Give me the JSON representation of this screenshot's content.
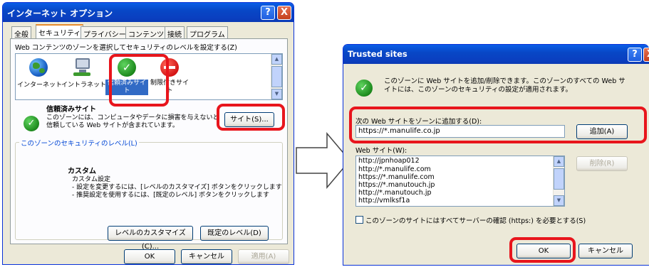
{
  "left_dialog": {
    "title": "インターネット オプション",
    "help_label": "?",
    "close_label": "X",
    "tabs": [
      "全般",
      "セキュリティ",
      "プライバシー",
      "コンテンツ",
      "接続",
      "プログラム"
    ],
    "zone_prompt": "Web コンテンツのゾーンを選択してセキュリティのレベルを設定する(Z)",
    "zones": [
      {
        "label": "インターネット",
        "icon": "globe-icon"
      },
      {
        "label": "イントラネット",
        "icon": "network-computer-icon"
      },
      {
        "label": "信頼済みサイト",
        "icon": "checkmark-icon"
      },
      {
        "label": "制限付きサイト",
        "icon": "forbidden-icon"
      }
    ],
    "zone_title": "信頼済みサイト",
    "zone_desc_line1": "このゾーンには、コンピュータやデータに損害を与えないと",
    "zone_desc_line2": "信頼している Web サイトが含まれています。",
    "sites_button": "サイト(S)...",
    "security_level_group": "このゾーンのセキュリティのレベル(L)",
    "custom_title": "カスタム",
    "custom_subtitle": "カスタム設定",
    "custom_bullet1": "- 設定を変更するには、[レベルのカスタマイズ] ボタンをクリックします",
    "custom_bullet2": "- 推奨設定を使用するには、[既定のレベル] ボタンをクリックします",
    "customize_button": "レベルのカスタマイズ(C)...",
    "default_button": "既定のレベル(D)",
    "ok": "OK",
    "cancel": "キャンセル",
    "apply": "適用(A)"
  },
  "right_dialog": {
    "title": "Trusted sites",
    "help_label": "?",
    "close_label": "X",
    "info_line1": "このゾーンに Web サイトを追加/削除できます。このゾーンのすべての Web サ",
    "info_line2": "イトには、このゾーンのセキュリティの設定が適用されます。",
    "add_label": "次の Web サイトをゾーンに追加する(D):",
    "add_value": "https://*.manulife.co.jp",
    "add_button": "追加(A)",
    "sites_label": "Web サイト(W):",
    "sites": [
      "http://jpnhoap012",
      "http://*.manulife.com",
      "https://*.manulife.com",
      "https://*.manutouch.jp",
      "http://*.manutouch.jp",
      "http://vmlksf1a"
    ],
    "remove_button": "削除(R)",
    "https_checkbox": "このゾーンのサイトにはすべてサーバーの確認 (https:) を必要とする(S)",
    "ok": "OK",
    "cancel": "キャンセル"
  },
  "colors": {
    "highlight": "#e8151c",
    "titlebar": "#0a3fc0",
    "dialog_bg": "#ece9d8"
  }
}
